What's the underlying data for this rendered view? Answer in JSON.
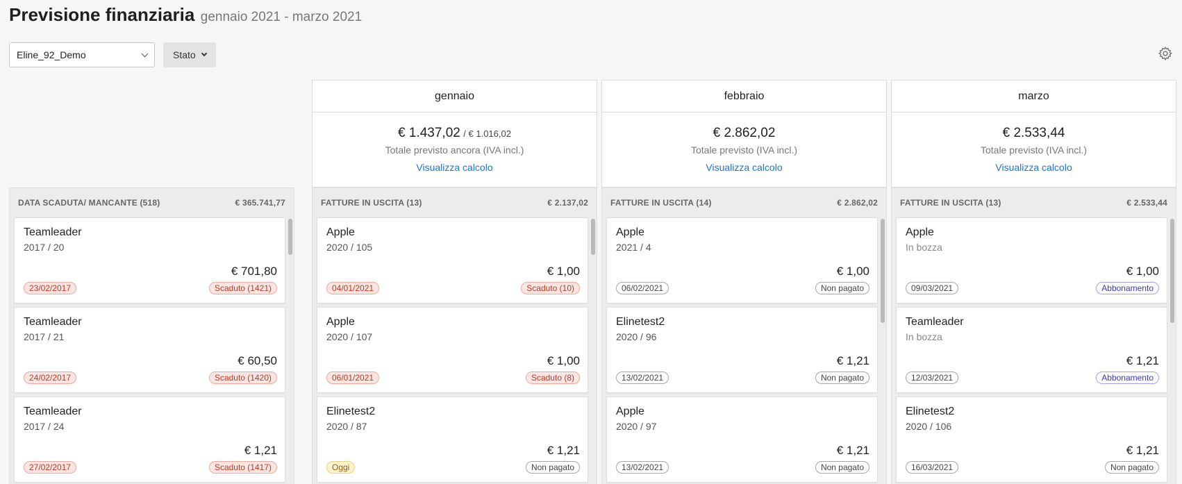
{
  "page": {
    "title": "Previsione finanziaria",
    "subtitle": "gennaio 2021 - marzo 2021"
  },
  "filters": {
    "account_value": "Eline_92_Demo",
    "stato_label": "Stato"
  },
  "months": [
    {
      "name": "gennaio",
      "total": "€ 1.437,02",
      "secondary": "/ € 1.016,02",
      "caption": "Totale previsto ancora (IVA incl.)",
      "link": "Visualizza calcolo"
    },
    {
      "name": "febbraio",
      "total": "€ 2.862,02",
      "secondary": "",
      "caption": "Totale previsto (IVA incl.)",
      "link": "Visualizza calcolo"
    },
    {
      "name": "marzo",
      "total": "€ 2.533,44",
      "secondary": "",
      "caption": "Totale previsto (IVA incl.)",
      "link": "Visualizza calcolo"
    }
  ],
  "columns": [
    {
      "header": "DATA SCADUTA/ MANCANTE (518)",
      "total": "€ 365.741,77",
      "cards": [
        {
          "name": "Teamleader",
          "ref": "2017 / 20",
          "amount": "€ 701,80",
          "date": "23/02/2017",
          "status": "Scaduto (1421)"
        },
        {
          "name": "Teamleader",
          "ref": "2017 / 21",
          "amount": "€ 60,50",
          "date": "24/02/2017",
          "status": "Scaduto (1420)"
        },
        {
          "name": "Teamleader",
          "ref": "2017 / 24",
          "amount": "€ 1,21",
          "date": "27/02/2017",
          "status": "Scaduto (1417)"
        }
      ]
    },
    {
      "header": "FATTURE IN USCITA (13)",
      "total": "€ 2.137,02",
      "cards": [
        {
          "name": "Apple",
          "ref": "2020 / 105",
          "amount": "€ 1,00",
          "date": "04/01/2021",
          "status": "Scaduto (10)"
        },
        {
          "name": "Apple",
          "ref": "2020 / 107",
          "amount": "€ 1,00",
          "date": "06/01/2021",
          "status": "Scaduto (8)"
        },
        {
          "name": "Elinetest2",
          "ref": "2020 / 87",
          "amount": "€ 1,21",
          "date": "Oggi",
          "status": "Non pagato"
        }
      ]
    },
    {
      "header": "FATTURE IN USCITA (14)",
      "total": "€ 2.862,02",
      "cards": [
        {
          "name": "Apple",
          "ref": "2021 / 4",
          "amount": "€ 1,00",
          "date": "06/02/2021",
          "status": "Non pagato"
        },
        {
          "name": "Elinetest2",
          "ref": "2020 / 96",
          "amount": "€ 1,21",
          "date": "13/02/2021",
          "status": "Non pagato"
        },
        {
          "name": "Apple",
          "ref": "2020 / 97",
          "amount": "€ 1,21",
          "date": "13/02/2021",
          "status": "Non pagato"
        }
      ]
    },
    {
      "header": "FATTURE IN USCITA (13)",
      "total": "€ 2.533,44",
      "cards": [
        {
          "name": "Apple",
          "ref": "In bozza",
          "amount": "€ 1,00",
          "date": "09/03/2021",
          "status": "Abbonamento"
        },
        {
          "name": "Teamleader",
          "ref": "In bozza",
          "amount": "€ 1,21",
          "date": "12/03/2021",
          "status": "Abbonamento"
        },
        {
          "name": "Elinetest2",
          "ref": "2020 / 106",
          "amount": "€ 1,21",
          "date": "16/03/2021",
          "status": "Non pagato"
        }
      ]
    }
  ],
  "colors": {
    "link": "#1b74d1",
    "overdue": "#b43b27",
    "today": "#8a6414",
    "subscription": "#3d37b6"
  },
  "icons": {
    "settings": "gear-icon",
    "dropdown": "chevron-down-icon"
  }
}
